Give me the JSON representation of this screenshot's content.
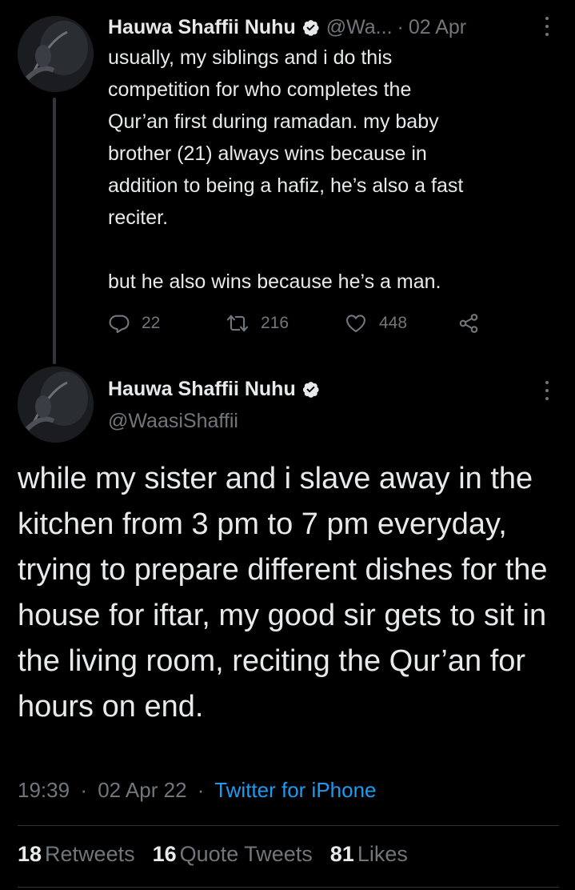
{
  "colors": {
    "background": "#000000",
    "text_primary": "#e7e9ea",
    "text_muted": "#71767b",
    "link": "#1d9bf0",
    "verified_badge": "#e7e9ea"
  },
  "parent_tweet": {
    "author_name": "Hauwa Shaffii Nuhu",
    "handle": "@Wa...",
    "separator": "·",
    "date": "02 Apr",
    "text": "usually, my siblings and i do this\ncompetition for who completes the\nQur’an first during ramadan. my baby\nbrother (21) always wins because in\naddition to being a hafiz, he’s also a fast\nreciter.\n\nbut he also wins because he’s a man.",
    "actions": {
      "reply_icon": "reply-icon",
      "reply_count": "22",
      "retweet_icon": "retweet-icon",
      "retweet_count": "216",
      "like_icon": "heart-icon",
      "like_count": "448",
      "share_icon": "share-icon"
    }
  },
  "main_tweet": {
    "author_name": "Hauwa Shaffii Nuhu",
    "handle": "@WaasiShaffii",
    "text": "while my sister and i slave away in the kitchen from 3 pm to 7 pm everyday, trying to prepare different dishes for the house for iftar, my good sir gets to sit in the living room, reciting the Qur’an for hours on end.",
    "time": "19:39",
    "separator": "·",
    "date": "02 Apr 22",
    "separator2": "·",
    "source": "Twitter for iPhone",
    "stats": {
      "retweets_count": "18",
      "retweets_label": "Retweets",
      "quotes_count": "16",
      "quotes_label": "Quote Tweets",
      "likes_count": "81",
      "likes_label": "Likes"
    }
  }
}
